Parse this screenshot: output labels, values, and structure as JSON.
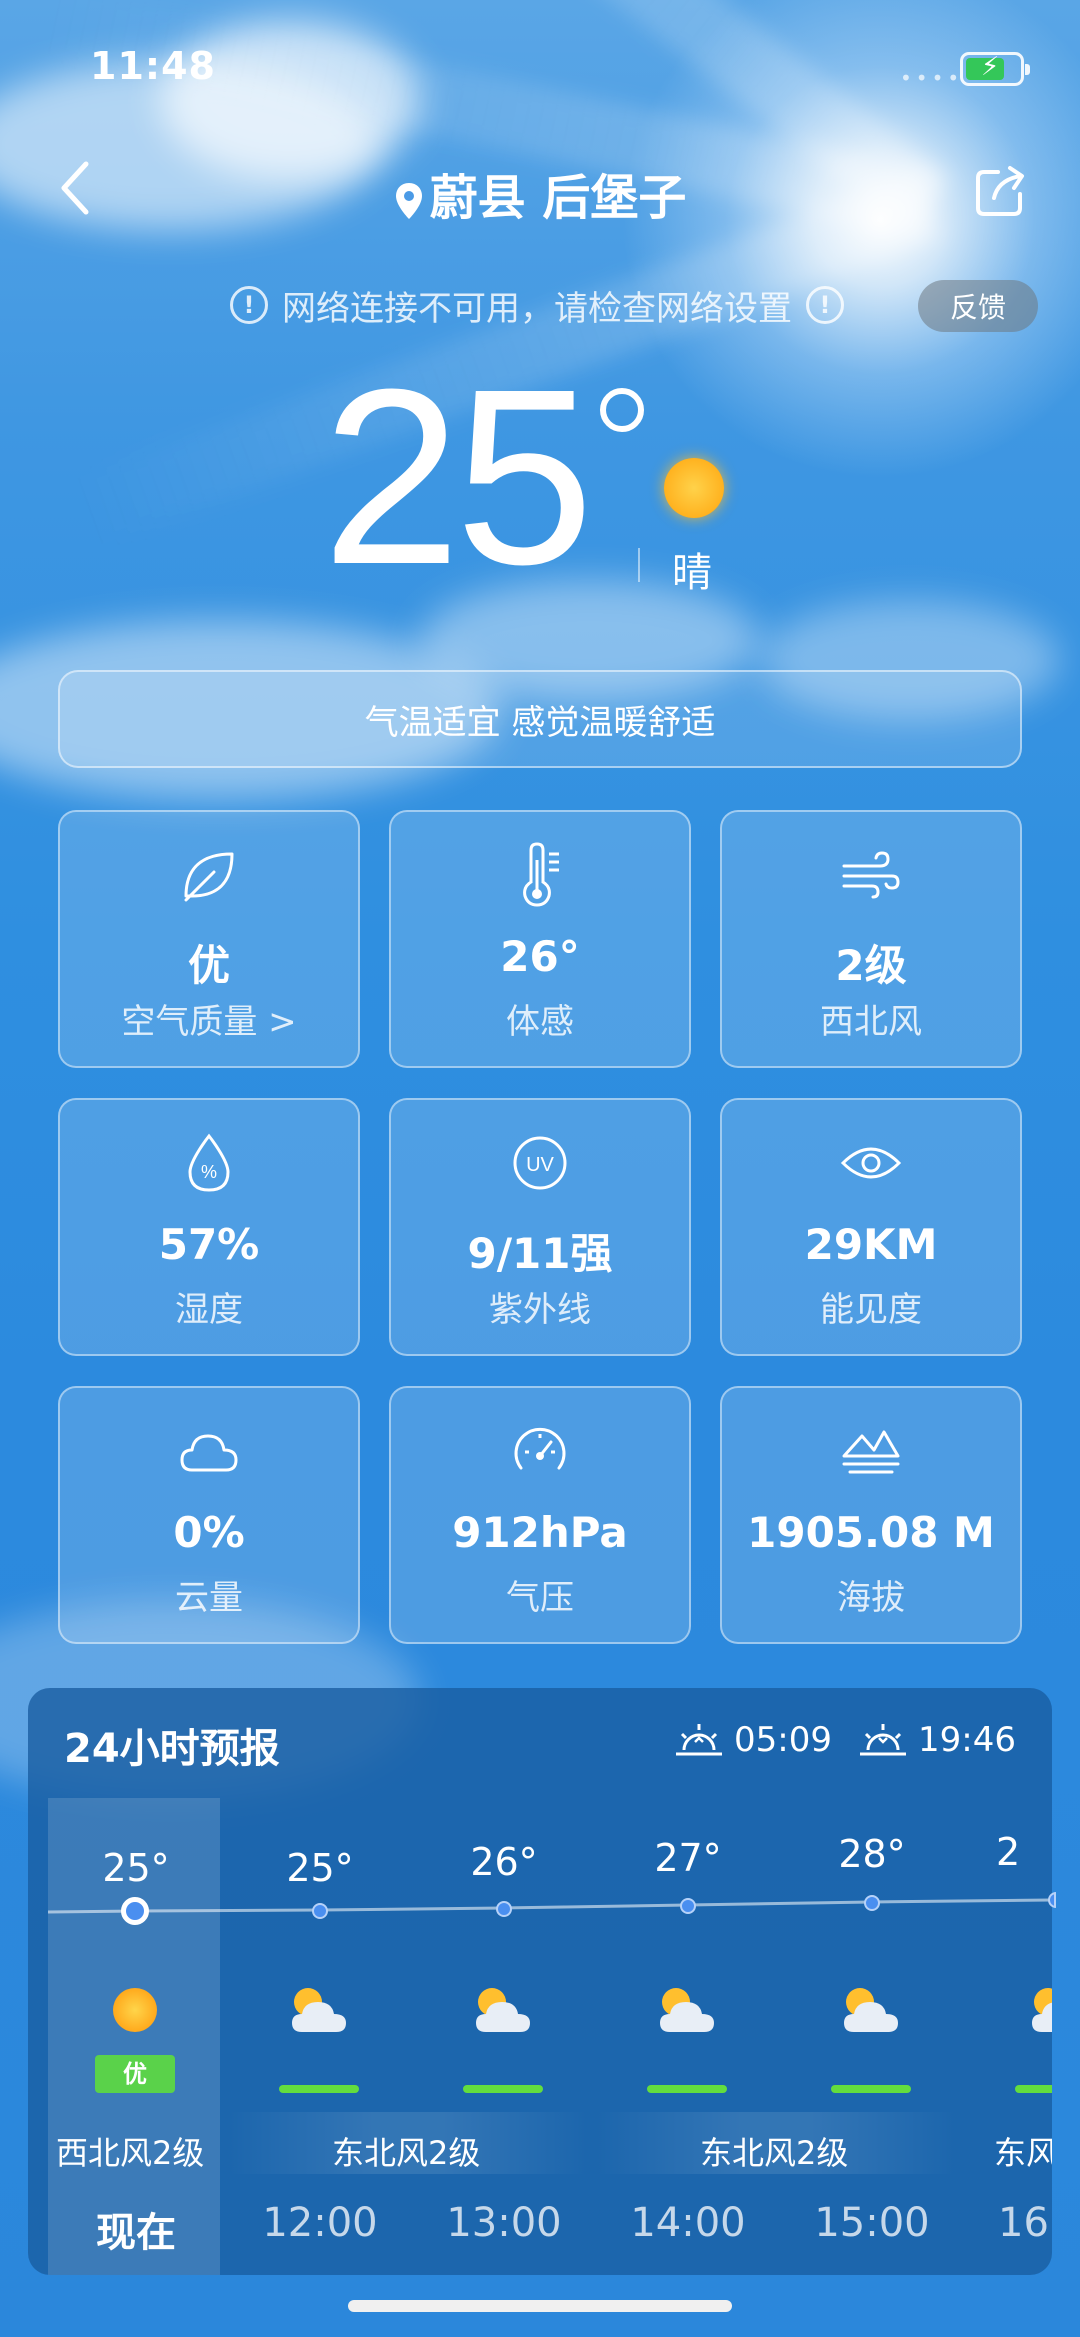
{
  "status_bar": {
    "time": "11:48"
  },
  "nav": {
    "location": "蔚县 后堡子"
  },
  "notice": {
    "message": "网络连接不可用，请检查网络设置",
    "feedback_label": "反馈"
  },
  "current": {
    "temperature": "25",
    "condition": "晴",
    "comfort": "气温适宜 感觉温暖舒适"
  },
  "metrics": [
    {
      "icon": "leaf-icon",
      "value": "优",
      "label": "空气质量 >"
    },
    {
      "icon": "thermometer-icon",
      "value": "26°",
      "label": "体感"
    },
    {
      "icon": "wind-icon",
      "value": "2级",
      "label": "西北风"
    },
    {
      "icon": "humidity-drop-icon",
      "value": "57%",
      "label": "湿度"
    },
    {
      "icon": "uv-icon",
      "value": "9/11强",
      "label": "紫外线"
    },
    {
      "icon": "eye-icon",
      "value": "29KM",
      "label": "能见度"
    },
    {
      "icon": "cloud-icon",
      "value": "0%",
      "label": "云量"
    },
    {
      "icon": "gauge-icon",
      "value": "912hPa",
      "label": "气压"
    },
    {
      "icon": "mountain-icon",
      "value": "1905.08 M",
      "label": "海拔"
    }
  ],
  "forecast": {
    "title": "24小时预报",
    "sunrise": "05:09",
    "sunset": "19:46",
    "hours": [
      {
        "time": "现在",
        "temp": "25°",
        "icon": "sun-icon",
        "aqi": "优"
      },
      {
        "time": "12:00",
        "temp": "25°",
        "icon": "partly-cloudy-icon"
      },
      {
        "time": "13:00",
        "temp": "26°",
        "icon": "partly-cloudy-icon"
      },
      {
        "time": "14:00",
        "temp": "27°",
        "icon": "partly-cloudy-icon"
      },
      {
        "time": "15:00",
        "temp": "28°",
        "icon": "partly-cloudy-icon"
      },
      {
        "time": "16:",
        "temp": "2",
        "icon": "partly-cloudy-icon"
      }
    ],
    "winds": [
      "西北风2级",
      "东北风2级",
      "东北风2级",
      "东风"
    ]
  }
}
